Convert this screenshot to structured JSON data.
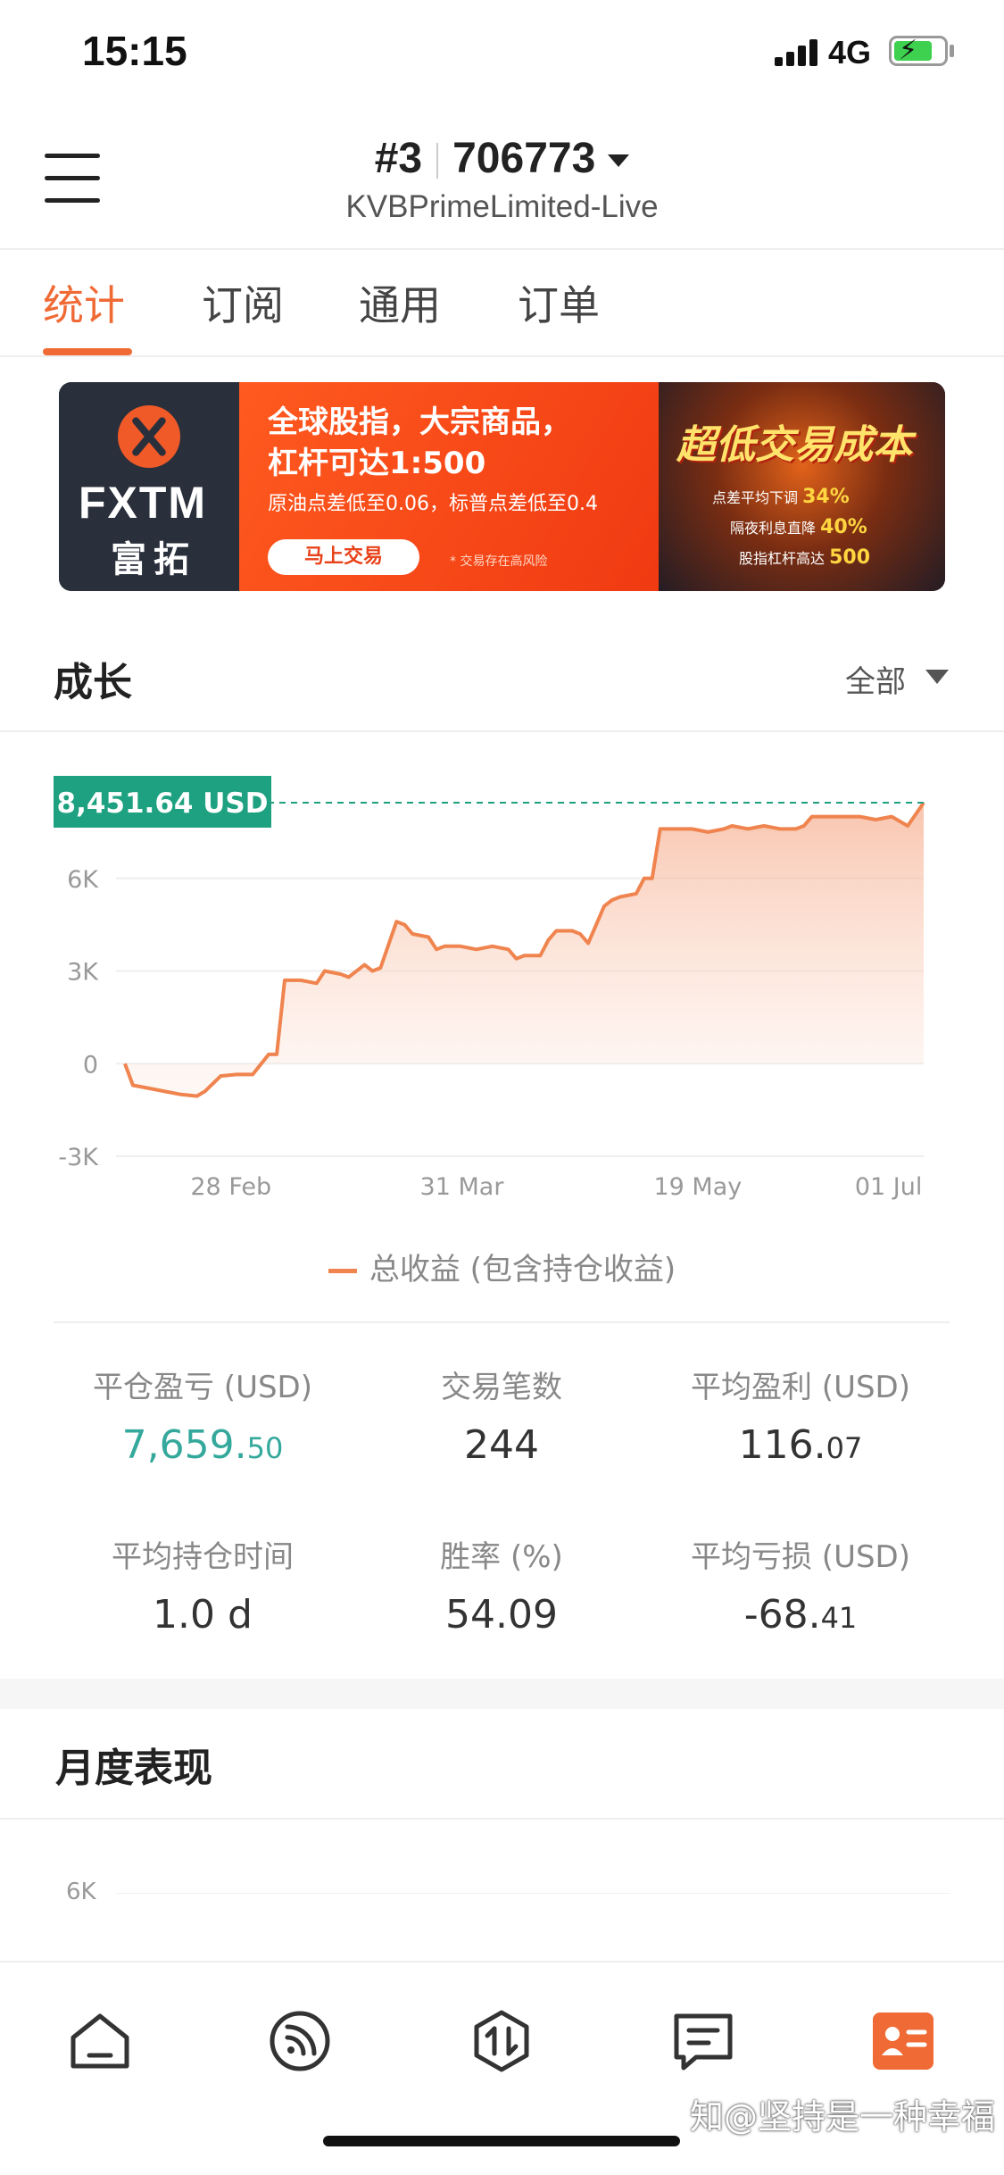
{
  "status_bar": {
    "time": "15:15",
    "network": "4G"
  },
  "header": {
    "account_prefix": "#3",
    "account_number": "706773",
    "broker": "KVBPrimeLimited-Live"
  },
  "tabs": [
    {
      "label": "统计",
      "active": true
    },
    {
      "label": "订阅",
      "active": false
    },
    {
      "label": "通用",
      "active": false
    },
    {
      "label": "订单",
      "active": false
    }
  ],
  "banner": {
    "logo": "FXTM",
    "logo_cn": "富拓",
    "line1": "全球股指，大宗商品，",
    "line2": "杠杆可达1:500",
    "subline": "原油点差低至0.06，标普点差低至0.4",
    "button": "马上交易",
    "risk": "* 交易存在高风险",
    "headline": "超低交易成本",
    "points": [
      {
        "label": "点差平均下调",
        "value": "34%"
      },
      {
        "label": "隔夜利息直降",
        "value": "40%"
      },
      {
        "label": "股指杠杆高达",
        "value": "500"
      }
    ]
  },
  "growth": {
    "title": "成长",
    "filter": "全部"
  },
  "chart_data": {
    "type": "area",
    "current_label": "8,451.64 USD",
    "current_value": 8451.64,
    "y_ticks": [
      "6K",
      "3K",
      "0",
      "-3K"
    ],
    "y_tick_values": [
      6000,
      3000,
      0,
      -3000
    ],
    "ylim": [
      -3000,
      9000
    ],
    "x_ticks": [
      "28 Feb",
      "31 Mar",
      "19 May",
      "01 Jul"
    ],
    "x_tick_positions": [
      0.23,
      0.46,
      0.695,
      0.885
    ],
    "series": [
      {
        "name": "总收益 (包含持仓收益)",
        "color": "#f0844f",
        "x": [
          0,
          0.01,
          0.03,
          0.05,
          0.07,
          0.09,
          0.1,
          0.12,
          0.14,
          0.16,
          0.18,
          0.19,
          0.2,
          0.22,
          0.24,
          0.25,
          0.27,
          0.28,
          0.3,
          0.31,
          0.32,
          0.34,
          0.35,
          0.36,
          0.38,
          0.39,
          0.4,
          0.42,
          0.44,
          0.46,
          0.48,
          0.49,
          0.5,
          0.52,
          0.53,
          0.54,
          0.56,
          0.57,
          0.58,
          0.6,
          0.61,
          0.62,
          0.64,
          0.65,
          0.66,
          0.67,
          0.69,
          0.71,
          0.73,
          0.75,
          0.76,
          0.78,
          0.8,
          0.82,
          0.84,
          0.85,
          0.86,
          0.88,
          0.9,
          0.92,
          0.94,
          0.96,
          0.98,
          1.0
        ],
        "values": [
          0,
          -700,
          -800,
          -900,
          -1000,
          -1050,
          -900,
          -400,
          -350,
          -350,
          300,
          300,
          2700,
          2700,
          2600,
          3000,
          2900,
          2800,
          3200,
          3000,
          3100,
          4600,
          4500,
          4200,
          4100,
          3700,
          3800,
          3800,
          3700,
          3800,
          3700,
          3400,
          3500,
          3500,
          4000,
          4300,
          4300,
          4200,
          3900,
          5100,
          5300,
          5400,
          5500,
          6000,
          6000,
          7600,
          7600,
          7600,
          7500,
          7600,
          7700,
          7600,
          7700,
          7600,
          7600,
          7700,
          8000,
          8000,
          8000,
          8000,
          7900,
          8000,
          7700,
          8451
        ]
      }
    ]
  },
  "stats": [
    {
      "label": "平仓盈亏 (USD)",
      "value_main": "7,659.",
      "value_dec": "50",
      "positive": true
    },
    {
      "label": "交易笔数",
      "value_main": "244",
      "value_dec": "",
      "positive": false
    },
    {
      "label": "平均盈利 (USD)",
      "value_main": "116.",
      "value_dec": "07",
      "positive": false
    },
    {
      "label": "平均持仓时间",
      "value_main": "1.0 d",
      "value_dec": "",
      "positive": false
    },
    {
      "label": "胜率 (%)",
      "value_main": "54.09",
      "value_dec": "",
      "positive": false
    },
    {
      "label": "平均亏损 (USD)",
      "value_main": "-68.",
      "value_dec": "41",
      "positive": false
    }
  ],
  "monthly": {
    "title": "月度表现",
    "first_tick": "6K"
  },
  "tabbar": [
    "home-icon",
    "feed-icon",
    "trade-icon",
    "message-icon",
    "profile-card-icon"
  ],
  "watermark": "知@坚持是一种幸福",
  "colors": {
    "accent": "#f06a35",
    "positive": "#35a89c",
    "label_bg": "#1ea180"
  }
}
